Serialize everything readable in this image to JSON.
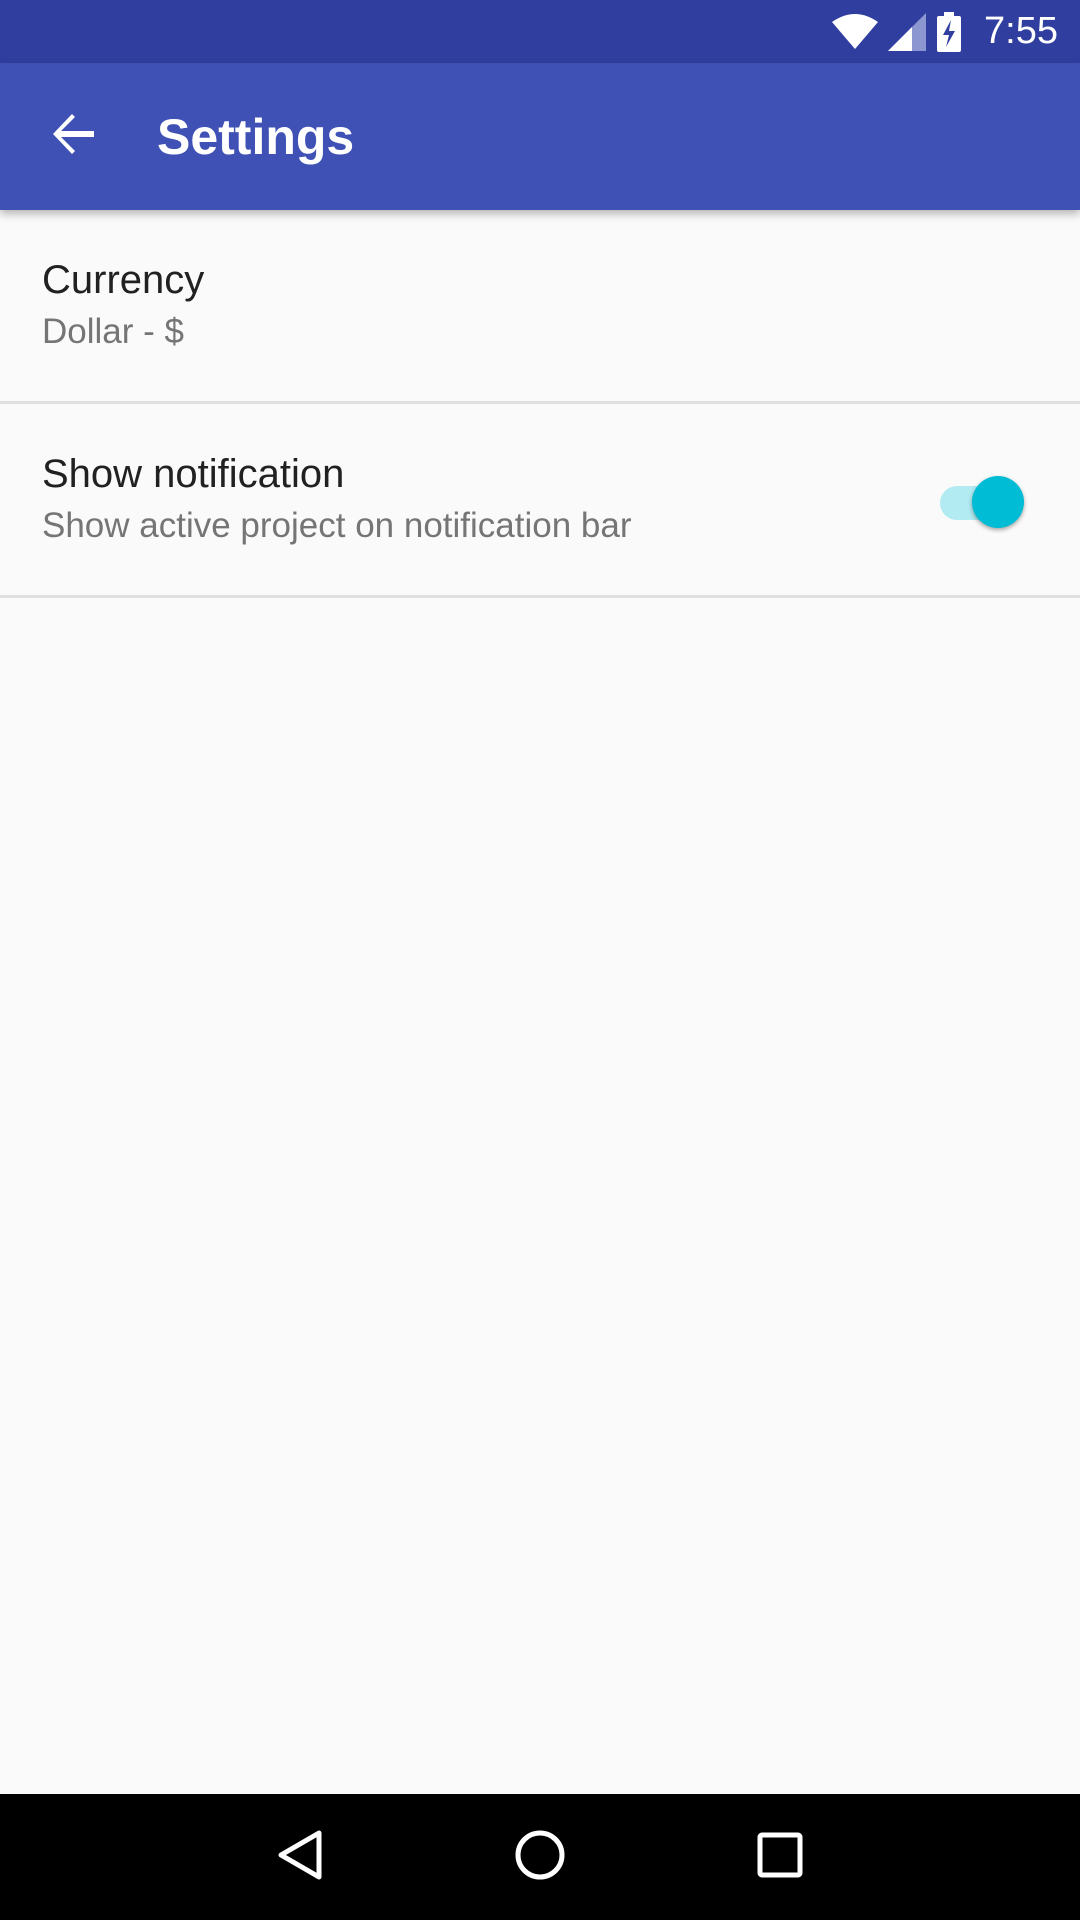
{
  "status_bar": {
    "time": "7:55",
    "icons": [
      "wifi-icon",
      "signal-icon",
      "battery-charging-icon"
    ]
  },
  "app_bar": {
    "title": "Settings",
    "back_icon": "arrow-back-icon",
    "color": "#3f51b5"
  },
  "settings": {
    "currency": {
      "title": "Currency",
      "summary": "Dollar - $"
    },
    "notification": {
      "title": "Show notification",
      "summary": "Show active project on notification bar",
      "enabled": true,
      "accent": "#00bcd4"
    }
  },
  "nav_bar": {
    "icons": [
      "back-triangle-icon",
      "home-circle-icon",
      "recents-square-icon"
    ]
  }
}
